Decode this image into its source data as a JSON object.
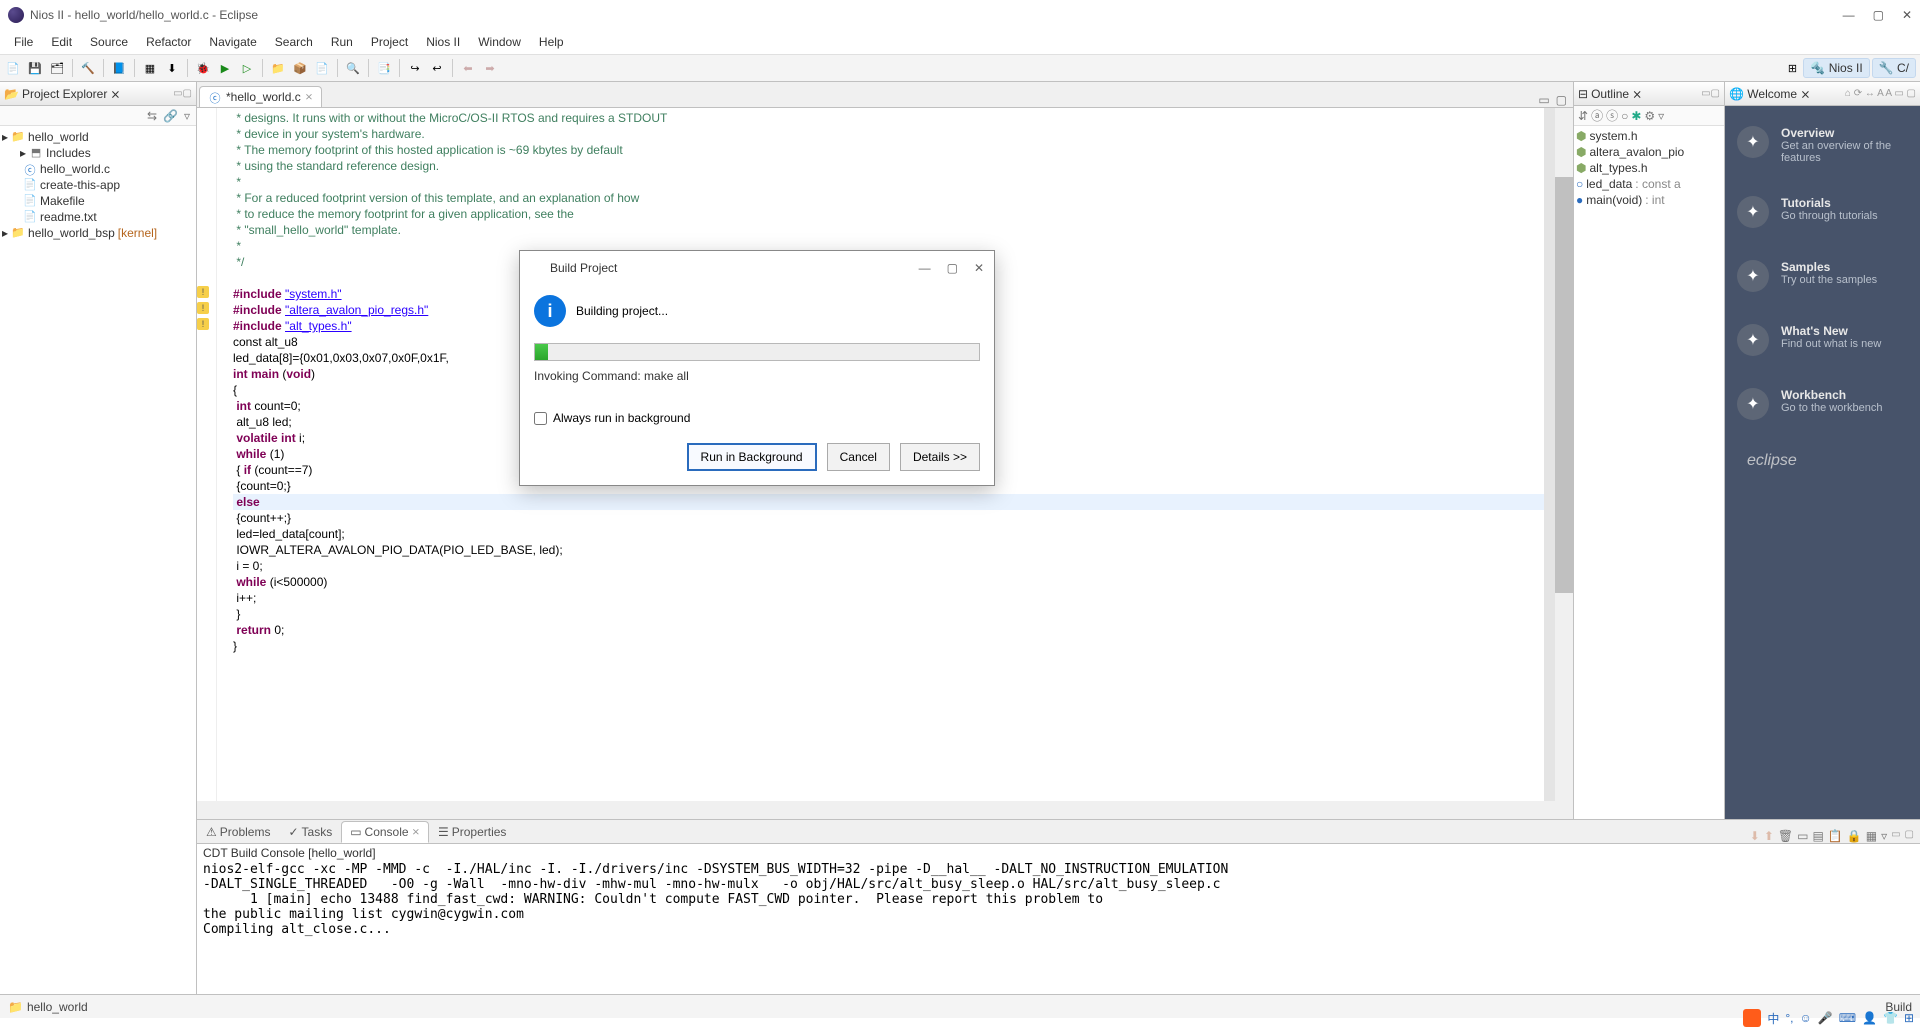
{
  "window": {
    "title": "Nios II - hello_world/hello_world.c - Eclipse"
  },
  "menus": [
    "File",
    "Edit",
    "Source",
    "Refactor",
    "Navigate",
    "Search",
    "Run",
    "Project",
    "Nios II",
    "Window",
    "Help"
  ],
  "perspectives": {
    "nios": "Nios II",
    "cpp": "C/"
  },
  "projectExplorer": {
    "title": "Project Explorer",
    "items": [
      {
        "label": "hello_world",
        "type": "project",
        "children": [
          {
            "label": "Includes",
            "icon": "includes"
          },
          {
            "label": "hello_world.c",
            "icon": "c"
          },
          {
            "label": "create-this-app",
            "icon": "file"
          },
          {
            "label": "Makefile",
            "icon": "file"
          },
          {
            "label": "readme.txt",
            "icon": "file"
          }
        ]
      },
      {
        "label": "hello_world_bsp",
        "suffix": "[kernel]",
        "type": "project"
      }
    ]
  },
  "editor": {
    "tab": "*hello_world.c",
    "lines": [
      {
        "cls": "cmt",
        "text": " * designs. It runs with or without the MicroC/OS-II RTOS and requires a STDOUT"
      },
      {
        "cls": "cmt",
        "text": " * device in your system's hardware."
      },
      {
        "cls": "cmt",
        "text": " * The memory footprint of this hosted application is ~69 kbytes by default"
      },
      {
        "cls": "cmt",
        "text": " * using the standard reference design."
      },
      {
        "cls": "cmt",
        "text": " *"
      },
      {
        "cls": "cmt",
        "text": " * For a reduced footprint version of this template, and an explanation of how"
      },
      {
        "cls": "cmt",
        "text": " * to reduce the memory footprint for a given application, see the"
      },
      {
        "cls": "cmt",
        "text": " * \"small_hello_world\" template."
      },
      {
        "cls": "cmt",
        "text": " *"
      },
      {
        "cls": "cmt",
        "text": " */"
      },
      {
        "cls": "",
        "text": ""
      },
      {
        "cls": "pp",
        "text": "#include \"system.h\"",
        "warn": true
      },
      {
        "cls": "pp",
        "text": "#include \"altera_avalon_pio_regs.h\"",
        "warn": true
      },
      {
        "cls": "pp",
        "text": "#include \"alt_types.h\"",
        "warn": true
      },
      {
        "cls": "dec",
        "text": "const alt_u8"
      },
      {
        "cls": "dec",
        "text": "led_data[8]={0x01,0x03,0x07,0x0F,0x1F,"
      },
      {
        "cls": "dec",
        "text": "int main (void)",
        "kwspan": [
          "int",
          "main",
          "void"
        ]
      },
      {
        "cls": "dec",
        "text": "{"
      },
      {
        "cls": "dec",
        "text": " int count=0;",
        "kwspan": [
          "int"
        ]
      },
      {
        "cls": "dec",
        "text": " alt_u8 led;"
      },
      {
        "cls": "dec",
        "text": " volatile int i;",
        "kwspan": [
          "volatile",
          "int"
        ]
      },
      {
        "cls": "dec",
        "text": " while (1)",
        "kwspan": [
          "while"
        ]
      },
      {
        "cls": "dec",
        "text": " { if (count==7)",
        "kwspan": [
          "if"
        ]
      },
      {
        "cls": "dec",
        "text": " {count=0;}"
      },
      {
        "cls": "dec",
        "text": " else",
        "kwspan": [
          "else"
        ],
        "current": true
      },
      {
        "cls": "dec",
        "text": " {count++;}"
      },
      {
        "cls": "dec",
        "text": " led=led_data[count];"
      },
      {
        "cls": "dec",
        "text": " IOWR_ALTERA_AVALON_PIO_DATA(PIO_LED_BASE, led);"
      },
      {
        "cls": "dec",
        "text": " i = 0;"
      },
      {
        "cls": "dec",
        "text": " while (i<500000)",
        "kwspan": [
          "while"
        ]
      },
      {
        "cls": "dec",
        "text": " i++;"
      },
      {
        "cls": "dec",
        "text": " }"
      },
      {
        "cls": "dec",
        "text": " return 0;",
        "kwspan": [
          "return"
        ]
      },
      {
        "cls": "dec",
        "text": "}"
      }
    ]
  },
  "outline": {
    "title": "Outline",
    "items": [
      {
        "icon": "h",
        "label": "system.h"
      },
      {
        "icon": "h",
        "label": "altera_avalon_pio"
      },
      {
        "icon": "h",
        "label": "alt_types.h"
      },
      {
        "icon": "var",
        "label": "led_data",
        "type": ": const a"
      },
      {
        "icon": "fn",
        "label": "main(void)",
        "type": ": int"
      }
    ]
  },
  "welcome": {
    "title": "Welcome",
    "items": [
      {
        "t": "Overview",
        "d": "Get an overview of the features"
      },
      {
        "t": "Tutorials",
        "d": "Go through tutorials"
      },
      {
        "t": "Samples",
        "d": "Try out the samples"
      },
      {
        "t": "What's New",
        "d": "Find out what is new"
      },
      {
        "t": "Workbench",
        "d": "Go to the workbench"
      }
    ],
    "logo": "eclipse"
  },
  "bottom": {
    "tabs": [
      "Problems",
      "Tasks",
      "Console",
      "Properties"
    ],
    "activeTab": "Console",
    "consoleTitle": "CDT Build Console [hello_world]",
    "consoleLines": [
      "nios2-elf-gcc -xc -MP -MMD -c  -I./HAL/inc -I. -I./drivers/inc -DSYSTEM_BUS_WIDTH=32 -pipe -D__hal__ -DALT_NO_INSTRUCTION_EMULATION",
      "-DALT_SINGLE_THREADED   -O0 -g -Wall  -mno-hw-div -mhw-mul -mno-hw-mulx   -o obj/HAL/src/alt_busy_sleep.o HAL/src/alt_busy_sleep.c",
      "      1 [main] echo 13488 find_fast_cwd: WARNING: Couldn't compute FAST_CWD pointer.  Please report this problem to",
      "the public mailing list cygwin@cygwin.com",
      "Compiling alt_close.c..."
    ]
  },
  "status": {
    "left": "hello_world",
    "right": "Build"
  },
  "dialog": {
    "title": "Build Project",
    "message": "Building project...",
    "sub": "Invoking Command: make all",
    "always": "Always run in background",
    "buttons": {
      "primary": "Run in Background",
      "cancel": "Cancel",
      "details": "Details >>"
    }
  }
}
